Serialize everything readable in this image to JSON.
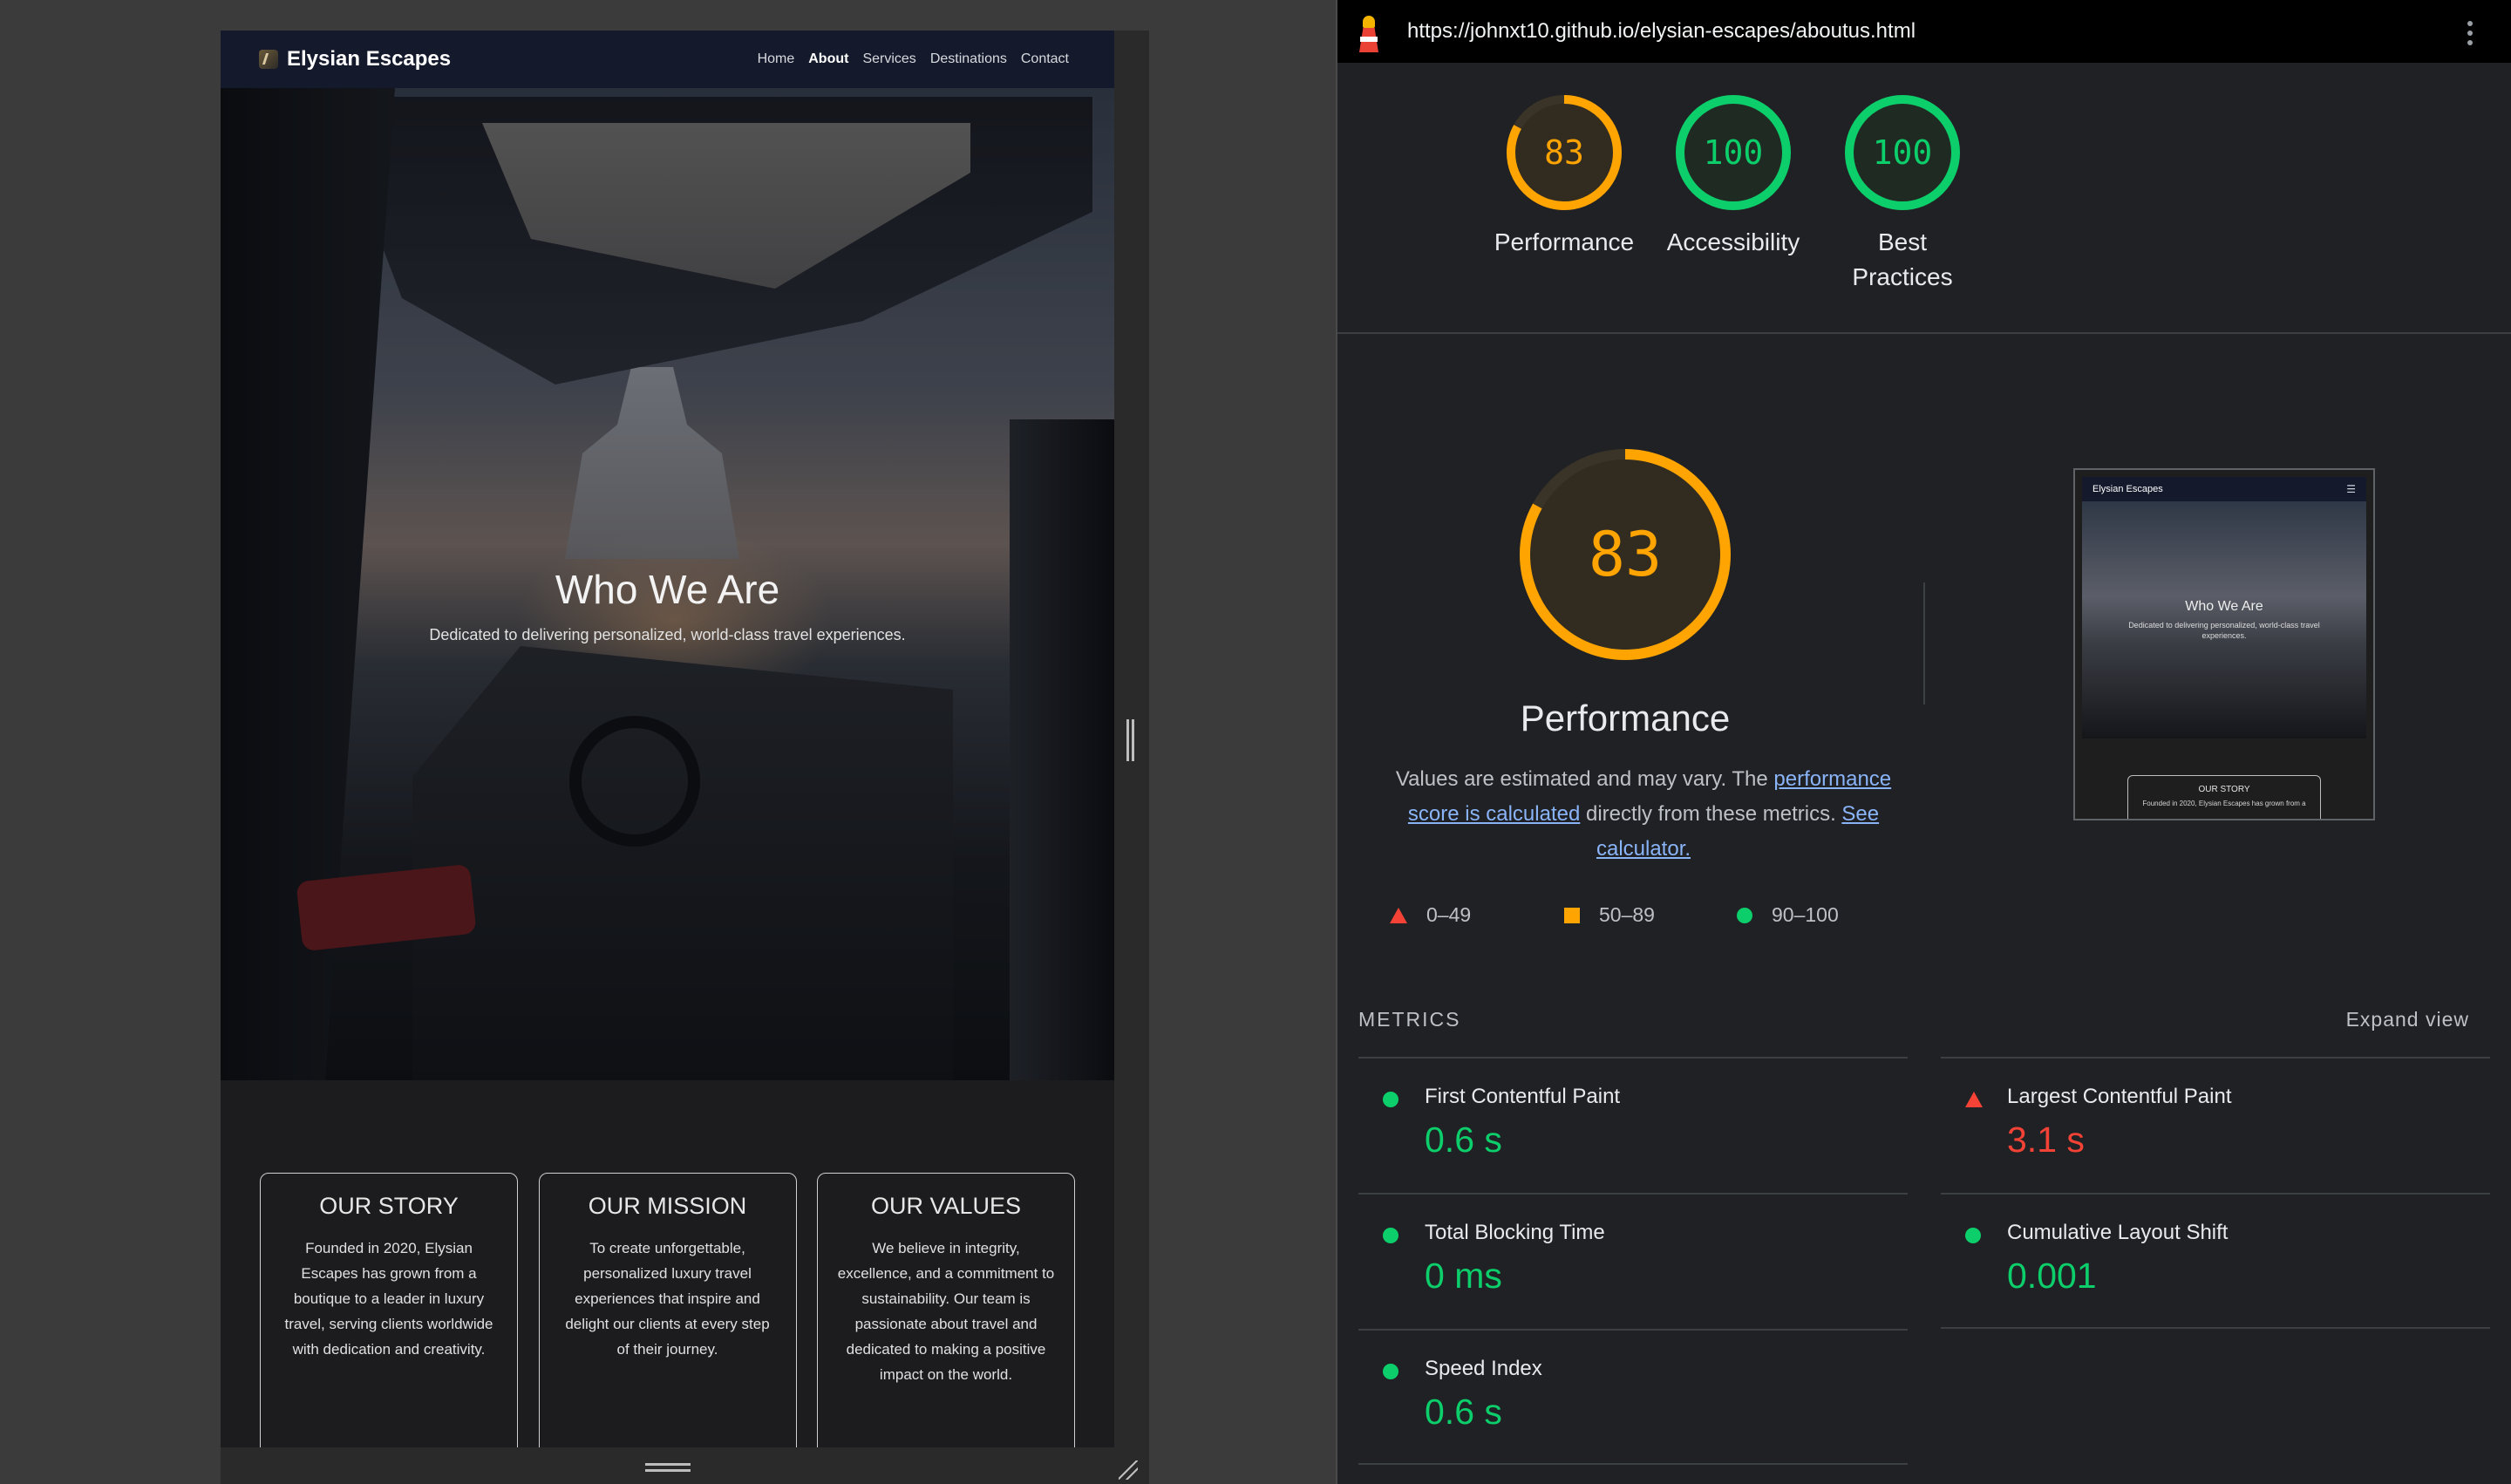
{
  "site": {
    "brand": "Elysian Escapes",
    "nav": [
      "Home",
      "About",
      "Services",
      "Destinations",
      "Contact"
    ],
    "active_nav": "About",
    "hero": {
      "title": "Who We Are",
      "subtitle": "Dedicated to delivering personalized, world-class travel experiences."
    },
    "cards": [
      {
        "title": "OUR STORY",
        "body": "Founded in 2020, Elysian Escapes has grown from a boutique to a leader in luxury travel, serving clients worldwide with dedication and creativity."
      },
      {
        "title": "OUR MISSION",
        "body": "To create unforgettable, personalized luxury travel experiences that inspire and delight our clients at every step of their journey."
      },
      {
        "title": "OUR VALUES",
        "body": "We believe in integrity, excellence, and a commitment to sustainability. Our team is passionate about travel and dedicated to making a positive impact on the world."
      }
    ]
  },
  "lighthouse": {
    "url": "https://johnxt10.github.io/elysian-escapes/aboutus.html",
    "scores": [
      {
        "label": "Performance",
        "value": 83,
        "color": "#ffa400"
      },
      {
        "label": "Accessibility",
        "value": 100,
        "color": "#0cce6b"
      },
      {
        "label": "Best Practices",
        "value": 100,
        "color": "#0cce6b"
      }
    ],
    "performance": {
      "score": 83,
      "label": "Performance",
      "desc_prefix": "Values are estimated and may vary. The ",
      "desc_link1": "performance score is calculated",
      "desc_middle": " directly from these metrics. ",
      "desc_link2": "See calculator."
    },
    "legend": [
      "0–49",
      "50–89",
      "90–100"
    ],
    "thumbnail": {
      "brand": "Elysian Escapes",
      "menu": "☰",
      "title": "Who We Are",
      "subtitle": "Dedicated to delivering personalized, world-class travel experiences.",
      "card_title": "OUR STORY",
      "card_body": "Founded in 2020, Elysian Escapes has grown from a"
    },
    "metrics_title": "METRICS",
    "expand_label": "Expand view",
    "metrics": [
      {
        "name": "First Contentful Paint",
        "value": "0.6 s",
        "status": "good"
      },
      {
        "name": "Largest Contentful Paint",
        "value": "3.1 s",
        "status": "bad"
      },
      {
        "name": "Total Blocking Time",
        "value": "0 ms",
        "status": "good"
      },
      {
        "name": "Cumulative Layout Shift",
        "value": "0.001",
        "status": "good"
      },
      {
        "name": "Speed Index",
        "value": "0.6 s",
        "status": "good"
      }
    ],
    "colors": {
      "good": "#0cce6b",
      "average": "#ffa400",
      "fail": "#f44336",
      "link": "#8ab4f8"
    }
  }
}
